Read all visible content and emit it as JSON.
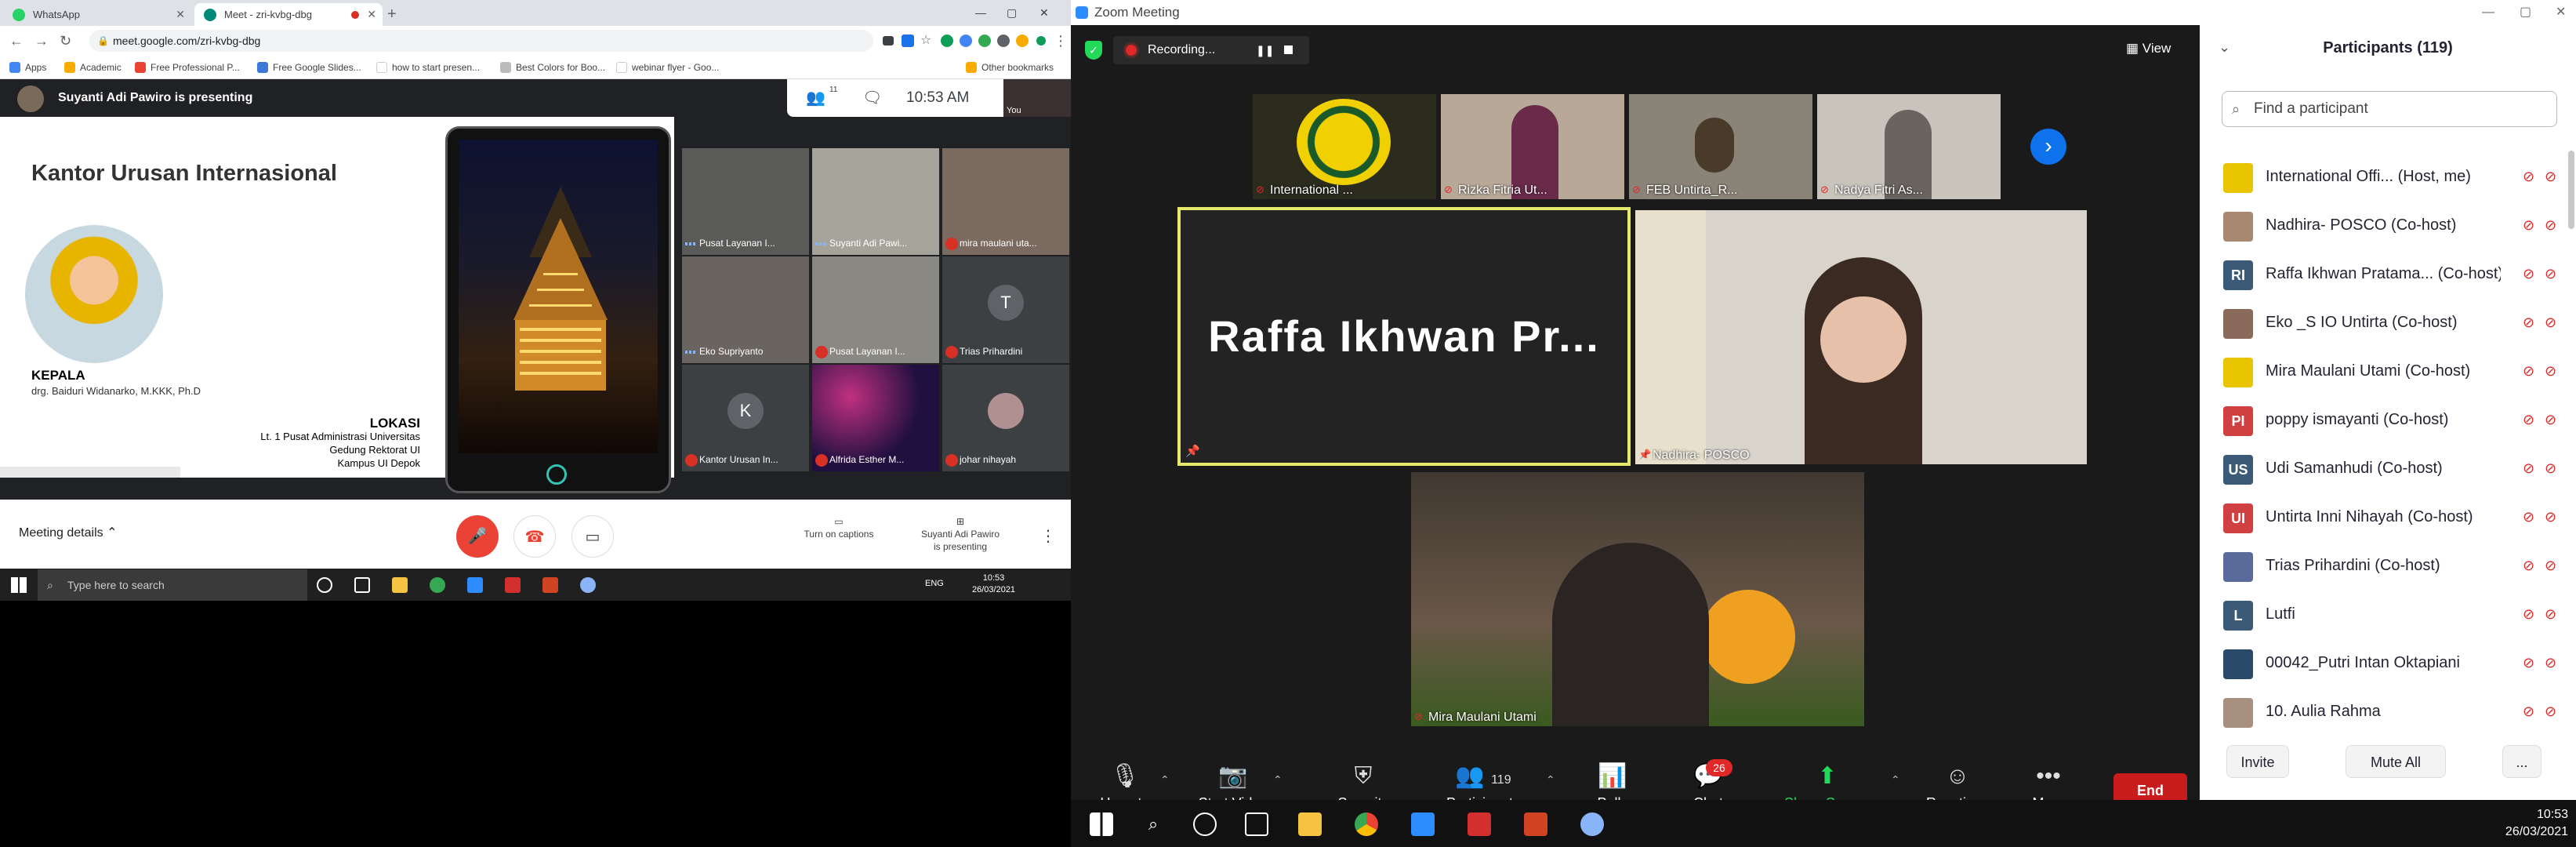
{
  "chrome": {
    "tabs": [
      {
        "label": "WhatsApp",
        "color": "#25d366"
      },
      {
        "label": "Meet - zri-kvbg-dbg",
        "color": "#00897b"
      }
    ],
    "url": "meet.google.com/zri-kvbg-dbg",
    "bookmarks": [
      "Apps",
      "Academic",
      "Free Professional P...",
      "Free Google Slides...",
      "how to start presen...",
      "Best Colors for Boo...",
      "webinar flyer - Goo...",
      "Other bookmarks"
    ]
  },
  "meet": {
    "presenter_banner": "Suyanti Adi Pawiro is presenting",
    "participant_count": "11",
    "time": "10:53 AM",
    "self_label": "You",
    "slide": {
      "title": "Kantor Urusan Internasional",
      "role": "KEPALA",
      "head_name": "drg. Baiduri Widanarko, M.KKK, Ph.D",
      "location_heading": "LOKASI",
      "location_lines": [
        "Lt. 1 Pusat Administrasi Universitas",
        "Gedung Rektorat UI",
        "Kampus UI Depok"
      ]
    },
    "tiles": [
      {
        "name": "Pusat Layanan I...",
        "muted": false
      },
      {
        "name": "Suyanti Adi Pawi...",
        "muted": false
      },
      {
        "name": "mira maulani uta...",
        "muted": true
      },
      {
        "name": "Eko Supriyanto",
        "muted": false
      },
      {
        "name": "Pusat Layanan I...",
        "muted": true
      },
      {
        "name": "Trias Prihardini",
        "muted": true,
        "letter": "T",
        "color": "#5f6368"
      },
      {
        "name": "Kantor Urusan In...",
        "muted": true,
        "letter": "K",
        "color": "#5f6368"
      },
      {
        "name": "Alfrida Esther M...",
        "muted": true
      },
      {
        "name": "johar nihayah",
        "muted": true
      }
    ],
    "meeting_details": "Meeting details",
    "captions_label": "Turn on captions",
    "presenting_label_line1": "Suyanti Adi Pawiro",
    "presenting_label_line2": "is presenting"
  },
  "win_taskbar": {
    "search_placeholder": "Type here to search",
    "lang": "ENG",
    "time": "10:53",
    "date": "26/03/2021"
  },
  "zoom": {
    "window_title": "Zoom Meeting",
    "recording_label": "Recording...",
    "view_label": "View",
    "gallery": [
      {
        "name": "International ...",
        "color": "#2b2b1e"
      },
      {
        "name": "Rizka Fitria Ut...",
        "color": "#b8a898"
      },
      {
        "name": "FEB Untirta_R...",
        "color": "#8a8478"
      },
      {
        "name": "Nadya Fitri As...",
        "color": "#c8c4bc"
      }
    ],
    "active_speaker": {
      "name": "Raffa Ikhwan Pr..."
    },
    "nadhira": {
      "name": "Nadhira- POSCO"
    },
    "mira": {
      "name": "Mira Maulani Utami"
    },
    "controls": {
      "unmute": "Unmute",
      "start_video": "Start Video",
      "security": "Security",
      "participants": "Participants",
      "participants_count": "119",
      "polls": "Polls",
      "chat": "Chat",
      "chat_badge": "26",
      "share_screen": "Share Screen",
      "reactions": "Reactions",
      "more": "More",
      "end": "End"
    },
    "panel": {
      "title": "Participants (119)",
      "search_placeholder": "Find a participant",
      "participants": [
        {
          "name": "International Offi... (Host, me)",
          "initials": "",
          "color": "#e8c500"
        },
        {
          "name": "Nadhira- POSCO (Co-host)",
          "initials": "",
          "color": "#a88870"
        },
        {
          "name": "Raffa Ikhwan Pratama... (Co-host)",
          "initials": "RI",
          "color": "#3a5a78"
        },
        {
          "name": "Eko _S IO Untirta (Co-host)",
          "initials": "",
          "color": "#8a6a5a"
        },
        {
          "name": "Mira Maulani Utami (Co-host)",
          "initials": "",
          "color": "#e8c500"
        },
        {
          "name": "poppy ismayanti (Co-host)",
          "initials": "PI",
          "color": "#d04040"
        },
        {
          "name": "Udi Samanhudi (Co-host)",
          "initials": "US",
          "color": "#3a5a78"
        },
        {
          "name": "Untirta Inni Nihayah (Co-host)",
          "initials": "UI",
          "color": "#d04040"
        },
        {
          "name": "Trias Prihardini (Co-host)",
          "initials": "",
          "color": "#5a6a9a"
        },
        {
          "name": "Lutfi",
          "initials": "L",
          "color": "#3a5a78"
        },
        {
          "name": "00042_Putri Intan Oktapiani",
          "initials": "",
          "color": "#2a4a6a"
        },
        {
          "name": "10. Aulia Rahma",
          "initials": "",
          "color": "#a89080"
        }
      ],
      "invite": "Invite",
      "mute_all": "Mute All",
      "more": "..."
    },
    "taskbar": {
      "time": "10:53",
      "date": "26/03/2021"
    }
  }
}
